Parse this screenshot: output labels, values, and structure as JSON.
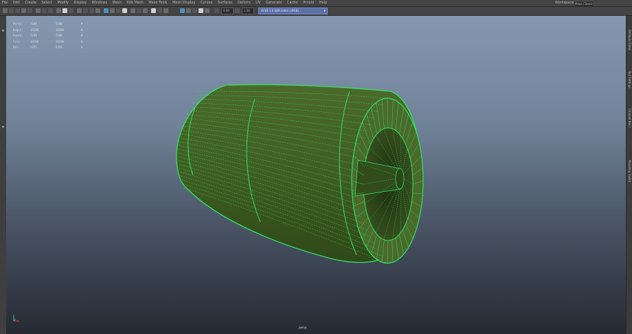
{
  "menubar": {
    "items": [
      "File",
      "Edit",
      "Create",
      "Select",
      "Modify",
      "Display",
      "Windows",
      "Mesh",
      "Edit Mesh",
      "Mesh Tools",
      "Mesh Display",
      "Curves",
      "Surfaces",
      "Deform",
      "UV",
      "Generate",
      "Cache",
      "Arnold",
      "Help"
    ],
    "workspace_label": "Workspace:",
    "workspace_value": "Maya Classic"
  },
  "toolbar": {
    "field1": "0.00",
    "field2": "1.00",
    "camera_select": "ACES 1.0 SDR-video (sRGB)"
  },
  "hud": {
    "rows": [
      {
        "label": "Verts:",
        "a": "5100",
        "b": "5100",
        "c": "0"
      },
      {
        "label": "Edges:",
        "a": "10200",
        "b": "10200",
        "c": "0"
      },
      {
        "label": "Faces:",
        "a": "5100",
        "b": "5100",
        "c": "0"
      },
      {
        "label": "Tris:",
        "a": "10200",
        "b": "10200",
        "c": "0"
      },
      {
        "label": "UVs:",
        "a": "5355",
        "b": "5355",
        "c": "0"
      }
    ]
  },
  "viewport": {
    "camera_label": "persp",
    "mesh_color": "#3d5a22",
    "wire_color": "#34e06a",
    "gradient_top": "#8598b0",
    "gradient_bottom": "#252a33"
  },
  "rightbar": {
    "tabs": [
      "Attribute Editor",
      "Tool Settings",
      "Channel Box / Layer Editor",
      "Modeling Toolkit"
    ]
  }
}
